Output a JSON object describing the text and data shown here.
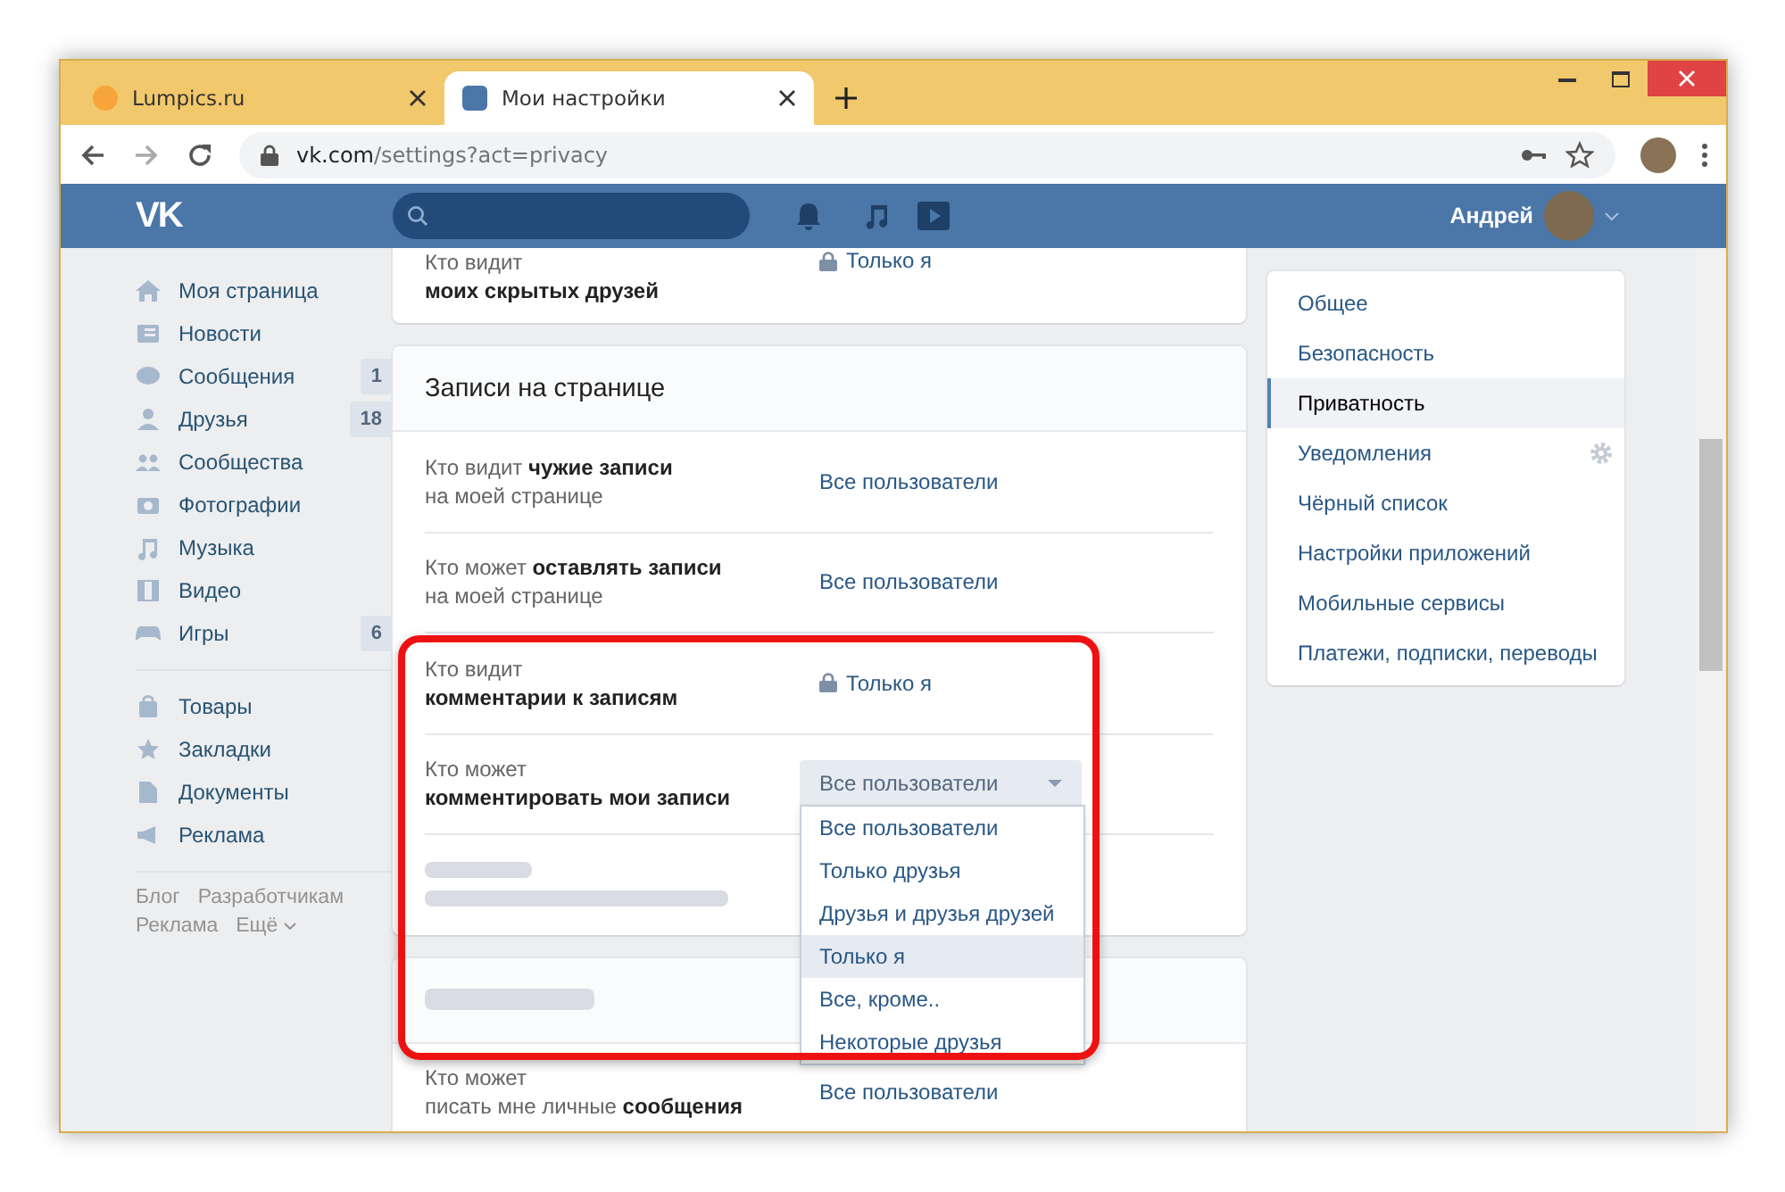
{
  "browser": {
    "tabs": [
      {
        "title": "Lumpics.ru",
        "selected": false
      },
      {
        "title": "Мои настройки",
        "selected": true
      }
    ],
    "address": {
      "host": "vk.com",
      "path": "/settings?act=privacy"
    }
  },
  "header": {
    "logo": "VK",
    "user_name": "Андрей"
  },
  "sidebar": {
    "items": [
      {
        "label": "Моя страница"
      },
      {
        "label": "Новости"
      },
      {
        "label": "Сообщения",
        "counter": "1"
      },
      {
        "label": "Друзья",
        "counter": "18"
      },
      {
        "label": "Сообщества"
      },
      {
        "label": "Фотографии"
      },
      {
        "label": "Музыка"
      },
      {
        "label": "Видео"
      },
      {
        "label": "Игры",
        "counter": "6"
      }
    ],
    "extra_items": [
      {
        "label": "Товары"
      },
      {
        "label": "Закладки"
      },
      {
        "label": "Документы"
      },
      {
        "label": "Реклама"
      }
    ],
    "footer_links": [
      "Блог",
      "Разработчикам",
      "Реклама",
      "Ещё"
    ]
  },
  "sections": [
    {
      "kind": "continued",
      "rows": [
        {
          "kind": "locked",
          "label": [
            "Кто видит",
            "**моих скрытых друзей**"
          ],
          "value": "Только я"
        }
      ]
    },
    {
      "kind": "titled",
      "title": "Записи на странице",
      "rows": [
        {
          "kind": "link",
          "label": [
            "Кто видит **чужие записи**",
            "на моей странице"
          ],
          "value": "Все пользователи"
        },
        {
          "kind": "link",
          "label": [
            "Кто может **оставлять записи**",
            "на моей странице"
          ],
          "value": "Все пользователи"
        },
        {
          "kind": "locked",
          "label": [
            "Кто видит",
            "**комментарии к записям**"
          ],
          "value": "Только я"
        },
        {
          "kind": "dropdown",
          "label": [
            "Кто может",
            "**комментировать мои записи**"
          ],
          "value": "Все пользователи",
          "options": [
            {
              "label": "Все пользователи",
              "hovered": false
            },
            {
              "label": "Только друзья",
              "hovered": false
            },
            {
              "label": "Друзья и друзья друзей",
              "hovered": false
            },
            {
              "label": "Только я",
              "hovered": true
            },
            {
              "label": "Все, кроме..",
              "hovered": false
            },
            {
              "label": "Некоторые друзья",
              "hovered": false
            }
          ]
        },
        {
          "kind": "blurred"
        }
      ]
    },
    {
      "kind": "obscured",
      "rows": [
        {
          "kind": "link",
          "label": [
            "Кто может",
            "писать мне личные **сообщения**"
          ],
          "value": "Все пользователи"
        }
      ]
    }
  ],
  "settings_menu": {
    "items": [
      {
        "label": "Общее",
        "selected": false,
        "has_settings": false
      },
      {
        "label": "Безопасность",
        "selected": false,
        "has_settings": false
      },
      {
        "label": "Приватность",
        "selected": true,
        "has_settings": false
      },
      {
        "label": "Уведомления",
        "selected": false,
        "has_settings": true
      },
      {
        "label": "Чёрный список",
        "selected": false,
        "has_settings": false
      },
      {
        "label": "Настройки приложений",
        "selected": false,
        "has_settings": false
      },
      {
        "label": "Мобильные сервисы",
        "selected": false,
        "has_settings": false
      },
      {
        "label": "Платежи, подписки, переводы",
        "selected": false,
        "has_settings": false
      }
    ]
  }
}
